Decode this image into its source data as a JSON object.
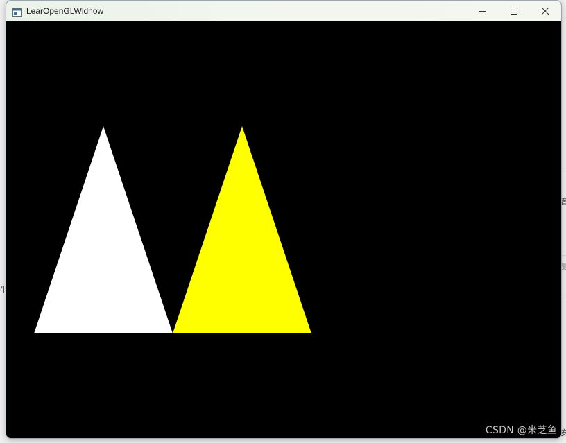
{
  "window": {
    "title": "LearOpenGLWidnow",
    "background_color": "#000000",
    "controls": {
      "minimize_icon": "minimize-icon",
      "maximize_icon": "maximize-icon",
      "close_icon": "close-icon"
    }
  },
  "scene": {
    "triangles": [
      {
        "name": "white-triangle",
        "color": "#ffffff"
      },
      {
        "name": "yellow-triangle",
        "color": "#ffff00"
      }
    ]
  },
  "background_fragments": {
    "right_top": "置",
    "right_mid": "复",
    "left_mid": "生",
    "bottom_right": "安"
  },
  "watermark": "CSDN @米芝鱼"
}
